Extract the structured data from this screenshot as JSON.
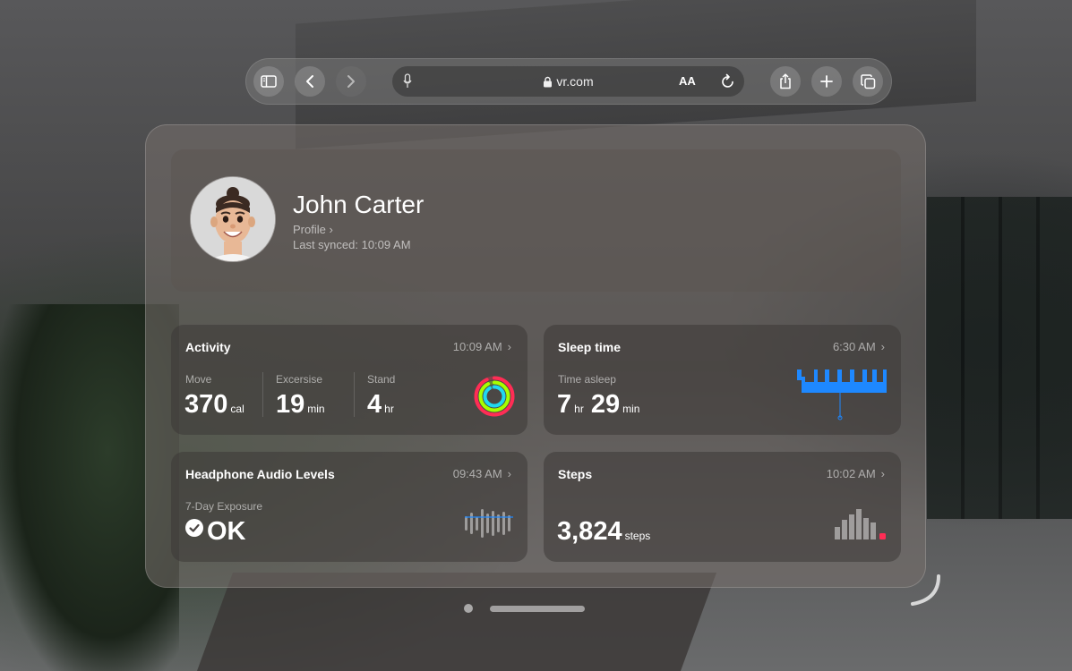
{
  "browser": {
    "url": "vr.com",
    "reader_label": "AA"
  },
  "profile": {
    "name": "John Carter",
    "link_label": "Profile",
    "last_synced": "Last synced: 10:09 AM"
  },
  "activity": {
    "title": "Activity",
    "time": "10:09 AM",
    "move_label": "Move",
    "move_value": "370",
    "move_unit": "cal",
    "exercise_label": "Excersise",
    "exercise_value": "19",
    "exercise_unit": "min",
    "stand_label": "Stand",
    "stand_value": "4",
    "stand_unit": "hr",
    "colors": {
      "move": "#ff2d55",
      "exercise": "#a6ff00",
      "stand": "#20d8f0"
    }
  },
  "sleep": {
    "title": "Sleep time",
    "time": "6:30 AM",
    "label": "Time asleep",
    "hours": "7",
    "hours_unit": "hr",
    "minutes": "29",
    "minutes_unit": "min",
    "color": "#1e88ff"
  },
  "audio": {
    "title": "Headphone Audio Levels",
    "time": "09:43 AM",
    "label": "7-Day Exposure",
    "status": "OK"
  },
  "steps": {
    "title": "Steps",
    "time": "10:02 AM",
    "value": "3,824",
    "unit": "steps",
    "accent": "#ff2d55"
  }
}
